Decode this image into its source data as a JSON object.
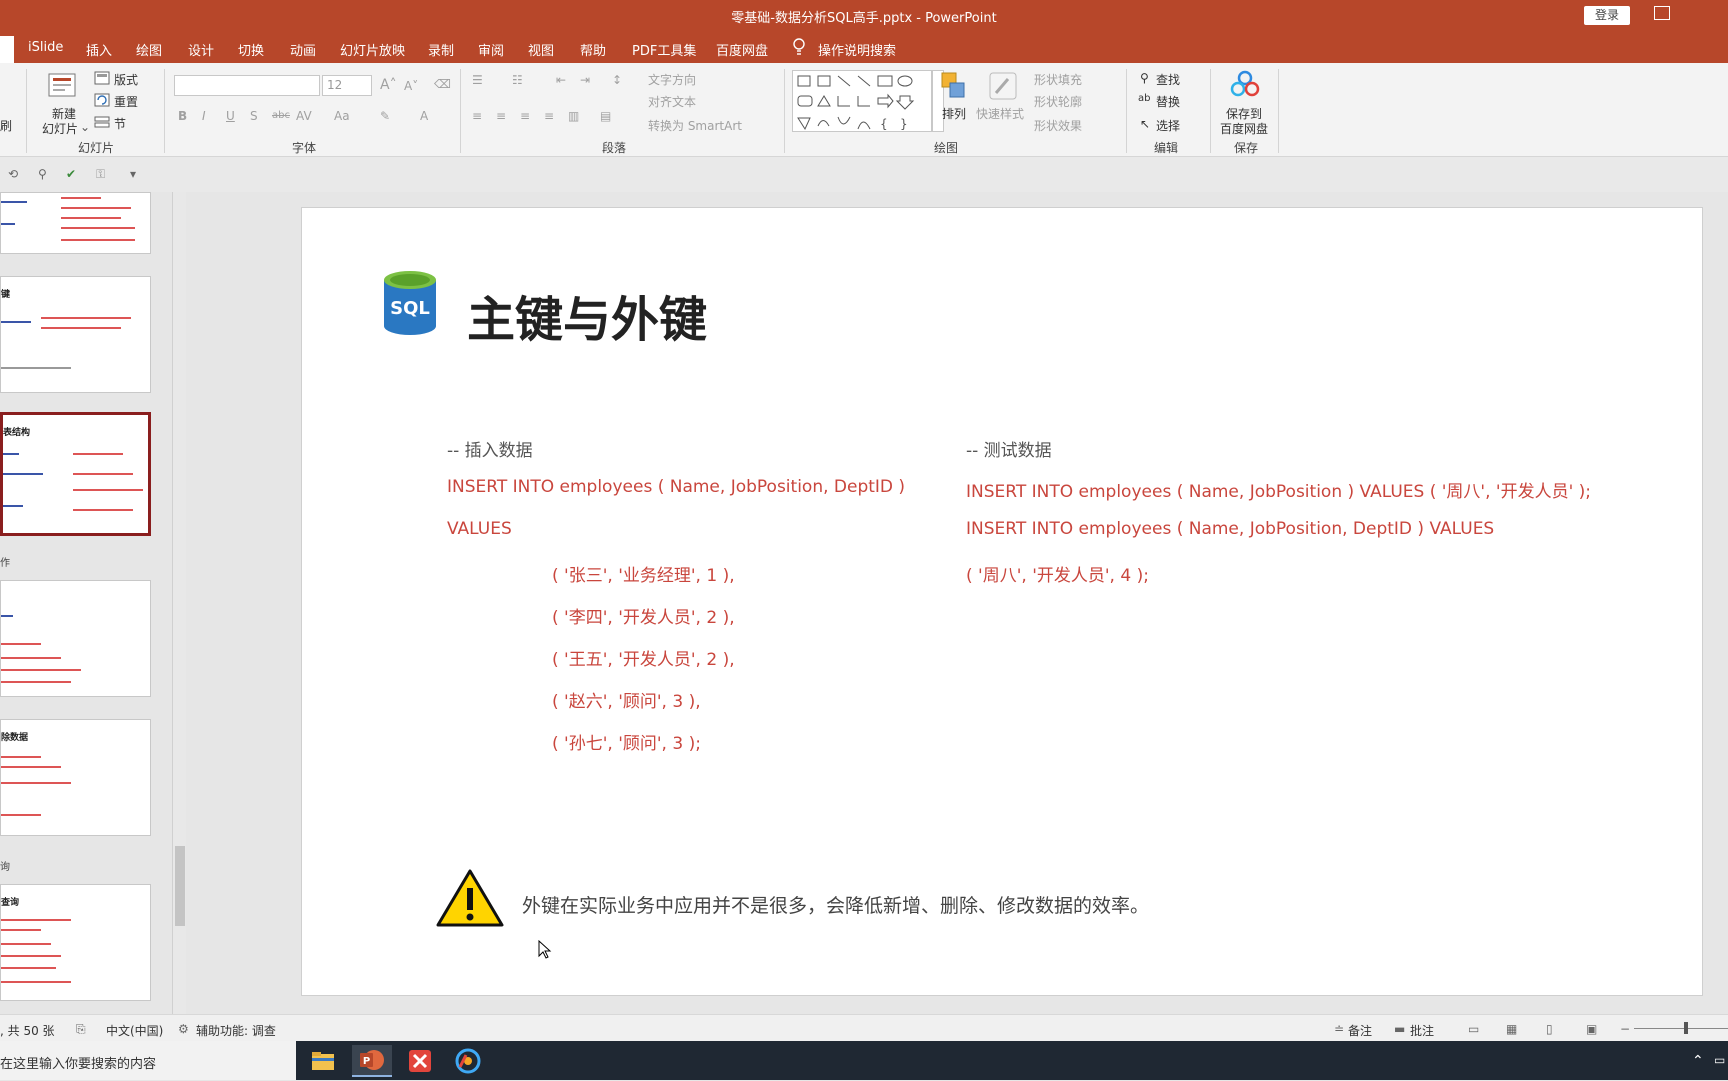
{
  "window": {
    "title": "零基础-数据分析SQL高手.pptx  -  PowerPoint",
    "login_label": "登录"
  },
  "menu": {
    "items": [
      "iSlide",
      "插入",
      "绘图",
      "设计",
      "切换",
      "动画",
      "幻灯片放映",
      "录制",
      "审阅",
      "视图",
      "帮助",
      "PDF工具集",
      "百度网盘"
    ],
    "tell_me": "操作说明搜索"
  },
  "ribbon": {
    "clipboard_partial": "刷",
    "slides": {
      "new_slide": "新建",
      "new_slide2": "幻灯片",
      "layout": "版式",
      "reset": "重置",
      "section": "节",
      "group": "幻灯片"
    },
    "font": {
      "size": "12",
      "group": "字体",
      "bold": "B",
      "italic": "I",
      "underline": "U",
      "shadow": "S",
      "strike": "abc",
      "spacing": "AV",
      "case": "Aa",
      "color": "A"
    },
    "paragraph": {
      "text_direction": "文字方向",
      "align_text": "对齐文本",
      "smartart": "转换为 SmartArt",
      "group": "段落"
    },
    "drawing": {
      "arrange": "排列",
      "quick_styles": "快速样式",
      "fill": "形状填充",
      "outline": "形状轮廓",
      "effects": "形状效果",
      "group": "绘图"
    },
    "editing": {
      "find": "查找",
      "replace": "替换",
      "select": "选择",
      "group": "编辑"
    },
    "save": {
      "save_to": "保存到",
      "baidu": "百度网盘",
      "group": "保存"
    }
  },
  "thumbnails": {
    "thumb2_title": "键",
    "thumb3_title": "表结构",
    "label_a": "作",
    "thumb5_title": "除数据",
    "label_b": "询",
    "thumb6_title": "查询"
  },
  "slide": {
    "title": "主键与外键",
    "logo_text": "SQL",
    "left": {
      "comment": "-- 插入数据",
      "line1": "INSERT INTO employees ( Name, JobPosition, DeptID )",
      "line2": "VALUES",
      "rows": [
        "( '张三', '业务经理', 1 ),",
        "( '李四', '开发人员', 2 ),",
        "( '王五', '开发人员', 2 ),",
        "( '赵六', '顾问', 3 ),",
        "( '孙七', '顾问', 3 );"
      ]
    },
    "right": {
      "comment": "-- 测试数据",
      "line1": "INSERT INTO employees ( Name, JobPosition ) VALUES ( '周八', '开发人员' );",
      "line2": "INSERT INTO employees ( Name, JobPosition, DeptID ) VALUES",
      "line3": "( '周八', '开发人员', 4 );"
    },
    "note": "外键在实际业务中应用并不是很多，会降低新增、删除、修改数据的效率。"
  },
  "status": {
    "slide_count": ", 共 50 张",
    "language": "中文(中国)",
    "accessibility": "辅助功能: 调查",
    "notes": "备注",
    "comments": "批注"
  },
  "taskbar": {
    "search_placeholder": "在这里输入你要搜索的内容"
  },
  "colors": {
    "accent": "#b7472a",
    "code": "#c9463d"
  }
}
